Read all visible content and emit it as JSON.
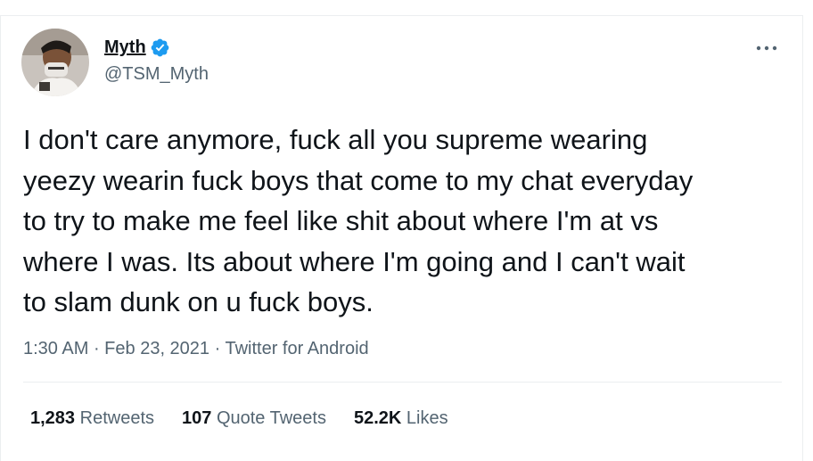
{
  "tweet": {
    "display_name": "Myth",
    "handle": "@TSM_Myth",
    "text": "I don't care anymore, fuck all you supreme wearing\nyeezy wearin fuck boys that come to my chat everyday\nto try to make me feel like shit about where I'm at vs\nwhere I was. Its about where I'm going and I can't wait\nto slam dunk on u fuck boys.",
    "time": "1:30 AM",
    "date": "Feb 23, 2021",
    "source": "Twitter for Android",
    "separator": " · "
  },
  "stats": {
    "retweets_count": "1,283",
    "retweets_label": "Retweets",
    "quotes_count": "107",
    "quotes_label": "Quote Tweets",
    "likes_count": "52.2K",
    "likes_label": "Likes"
  },
  "icons": {
    "verified": "verified-badge-icon",
    "more": "more-options-icon"
  },
  "colors": {
    "text": "#0f1419",
    "secondary": "#536471",
    "verified": "#1d9bf0",
    "border": "#ebeef0"
  }
}
